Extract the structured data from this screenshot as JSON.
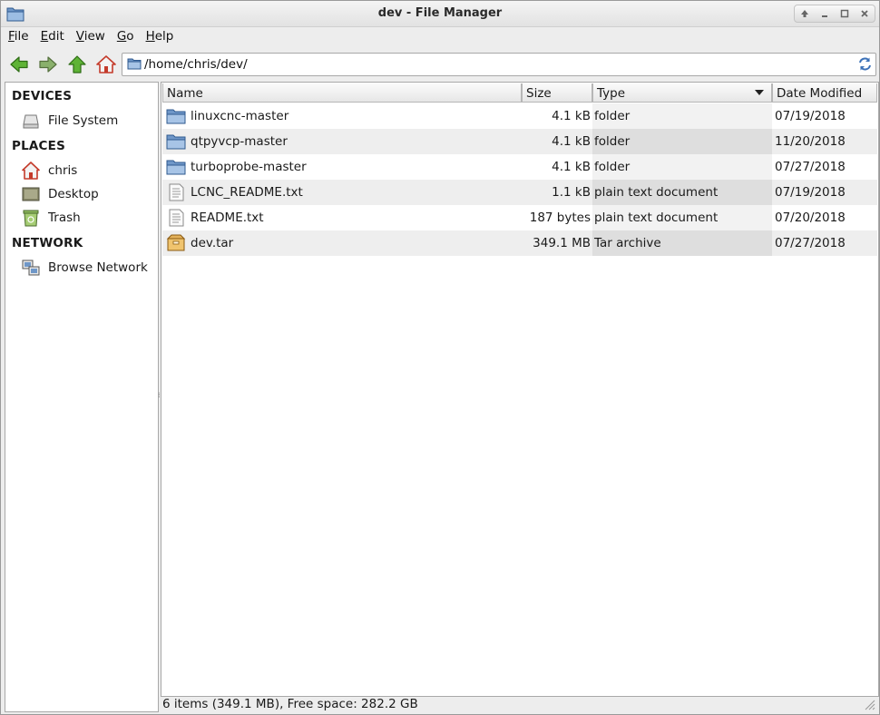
{
  "window": {
    "title": "dev - File Manager"
  },
  "menu": {
    "items": [
      {
        "mnemonic": "F",
        "rest": "ile"
      },
      {
        "mnemonic": "E",
        "rest": "dit"
      },
      {
        "mnemonic": "V",
        "rest": "iew"
      },
      {
        "mnemonic": "G",
        "rest": "o"
      },
      {
        "mnemonic": "H",
        "rest": "elp"
      }
    ]
  },
  "toolbar": {
    "buttons": [
      "back-icon",
      "forward-icon",
      "up-icon",
      "home-icon"
    ],
    "location": "/home/chris/dev/"
  },
  "sidebar": {
    "devices_heading": "DEVICES",
    "devices": [
      {
        "label": "File System",
        "icon": "drive-icon"
      }
    ],
    "places_heading": "PLACES",
    "places": [
      {
        "label": "chris",
        "icon": "home-folder-icon"
      },
      {
        "label": "Desktop",
        "icon": "desktop-icon"
      },
      {
        "label": "Trash",
        "icon": "trash-icon"
      }
    ],
    "network_heading": "NETWORK",
    "network": [
      {
        "label": "Browse Network",
        "icon": "network-icon"
      }
    ]
  },
  "filelist": {
    "columns": {
      "name": "Name",
      "size": "Size",
      "type": "Type",
      "date": "Date Modified"
    },
    "sorted_by": "Type",
    "rows": [
      {
        "name": "linuxcnc-master",
        "size": "4.1 kB",
        "type": "folder",
        "date": "07/19/2018",
        "icon": "folder-icon"
      },
      {
        "name": "qtpyvcp-master",
        "size": "4.1 kB",
        "type": "folder",
        "date": "11/20/2018",
        "icon": "folder-icon"
      },
      {
        "name": "turboprobe-master",
        "size": "4.1 kB",
        "type": "folder",
        "date": "07/27/2018",
        "icon": "folder-icon"
      },
      {
        "name": "LCNC_README.txt",
        "size": "1.1 kB",
        "type": "plain text document",
        "date": "07/19/2018",
        "icon": "text-file-icon"
      },
      {
        "name": "README.txt",
        "size": "187 bytes",
        "type": "plain text document",
        "date": "07/20/2018",
        "icon": "text-file-icon"
      },
      {
        "name": "dev.tar",
        "size": "349.1 MB",
        "type": "Tar archive",
        "date": "07/27/2018",
        "icon": "archive-icon"
      }
    ]
  },
  "status": {
    "text": "6 items (349.1 MB), Free space: 282.2 GB"
  },
  "colors": {
    "folder": "#6f97c8",
    "arrow_green": "#4fa22a",
    "home_red": "#c43b2b",
    "alt_row": "#eeeeee"
  }
}
